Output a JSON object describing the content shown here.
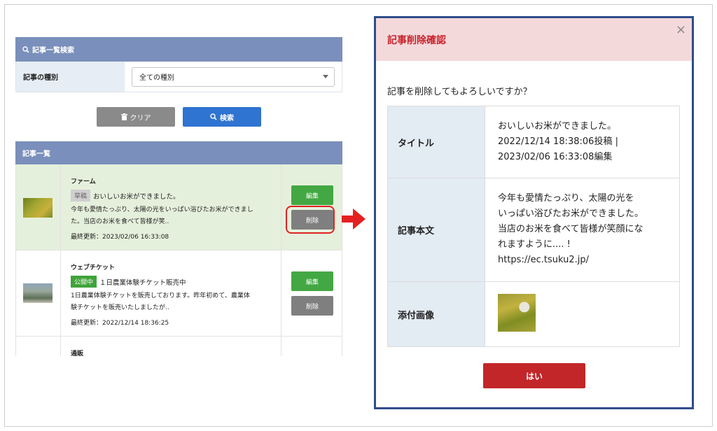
{
  "search": {
    "header": "記事一覧検索",
    "type_label": "記事の種別",
    "type_value": "全ての種別",
    "clear_label": "クリア",
    "search_label": "検索"
  },
  "list": {
    "header": "記事一覧",
    "articles": [
      {
        "category": "ファーム",
        "status": "草稿",
        "title": "おいしいお米ができました。",
        "excerpt_line1": "今年も愛情たっぷり、太陽の光をいっぱい浴びたお米ができまし",
        "excerpt_line2": "た。当店のお米を食べて皆様が笑..",
        "updated": "最終更新：2023/02/06 16:33:08",
        "edit_label": "編集",
        "delete_label": "削除"
      },
      {
        "category": "ウェブチケット",
        "status": "公開中",
        "title": "１日農業体験チケット販売中",
        "excerpt_line1": "1日農業体験チケットを販売しております。昨年初めて、農業体",
        "excerpt_line2": "験チケットを販売いたしましたが..",
        "updated": "最終更新：2022/12/14 18:36:25",
        "edit_label": "編集",
        "delete_label": "削除"
      },
      {
        "category": "通販"
      }
    ]
  },
  "modal": {
    "title": "記事削除確認",
    "close": "×",
    "question": "記事を削除してもよろしいですか？",
    "rows": {
      "title_label": "タイトル",
      "title_line1": "おいしいお米ができました。",
      "title_line2": "2022/12/14 18:38:06投稿 |",
      "title_line3": "2023/02/06 16:33:08編集",
      "body_label": "記事本文",
      "body_line1": "今年も愛情たっぷり、太陽の光を",
      "body_line2": "いっぱい浴びたお米ができました。",
      "body_line3": "当店のお米を食べて皆様が笑顔にな",
      "body_line4": "れますように.... !",
      "body_line5": "https://ec.tsuku2.jp/",
      "image_label": "添付画像"
    },
    "yes_label": "はい"
  },
  "colors": {
    "header_blue": "#7a8fbb",
    "primary_blue": "#2f74d0",
    "edit_green": "#43a843",
    "danger_red": "#c22629",
    "highlight_red": "#e02222",
    "modal_border": "#2f4d8a"
  }
}
